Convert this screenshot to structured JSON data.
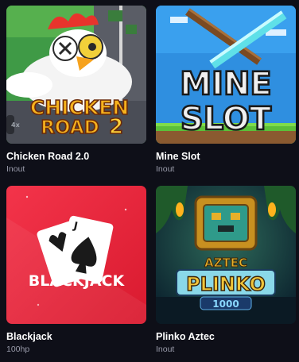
{
  "games": [
    {
      "title": "Chicken Road 2.0",
      "provider": "Inout",
      "art_text_line1": "CHICKEN",
      "art_text_line2": "ROAD",
      "art_text_line3": "2",
      "art_badge": "4x",
      "colors": {
        "bg": "#3f9a46",
        "accent": "#f6b21d"
      }
    },
    {
      "title": "Mine Slot",
      "provider": "Inout",
      "art_text_line1": "MINE",
      "art_text_line2": "SLOT",
      "colors": {
        "bg": "#2f8fe0",
        "accent": "#e8e8e8"
      }
    },
    {
      "title": "Blackjack",
      "provider": "100hp",
      "art_text_line1": "BLACKJACK",
      "art_card_rank": "J",
      "colors": {
        "bg": "#e8233a",
        "accent": "#ffffff"
      }
    },
    {
      "title": "Plinko Aztec",
      "provider": "Inout",
      "art_text_line1": "AZTEC",
      "art_text_line2": "PLINKO",
      "art_text_line3": "1000",
      "colors": {
        "bg": "#0f2a3d",
        "accent": "#e6b02a"
      }
    }
  ]
}
